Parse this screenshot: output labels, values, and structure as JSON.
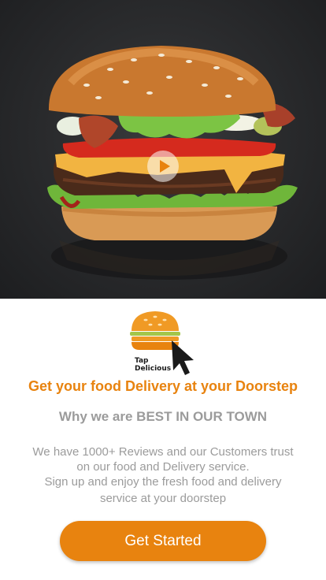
{
  "hero": {
    "image_name": "burger-photo",
    "play_icon": "play-icon"
  },
  "logo": {
    "line1": "Tap",
    "line2": "Delicious",
    "icon": "burger-cursor-logo"
  },
  "headline": "Get your food Delivery at your Doorstep",
  "subheadline": "Why we are BEST IN OUR TOWN",
  "description": {
    "line1": "We have 1000+ Reviews and our Customers trust",
    "line2": "on our food and Delivery service.",
    "line3": "Sign up and enjoy the fresh food and delivery",
    "line4": "service at your doorstep"
  },
  "cta_label": "Get Started",
  "colors": {
    "accent": "#e8830f",
    "muted_text": "#9b9b9b",
    "hero_bg": "#2b2c2e"
  }
}
